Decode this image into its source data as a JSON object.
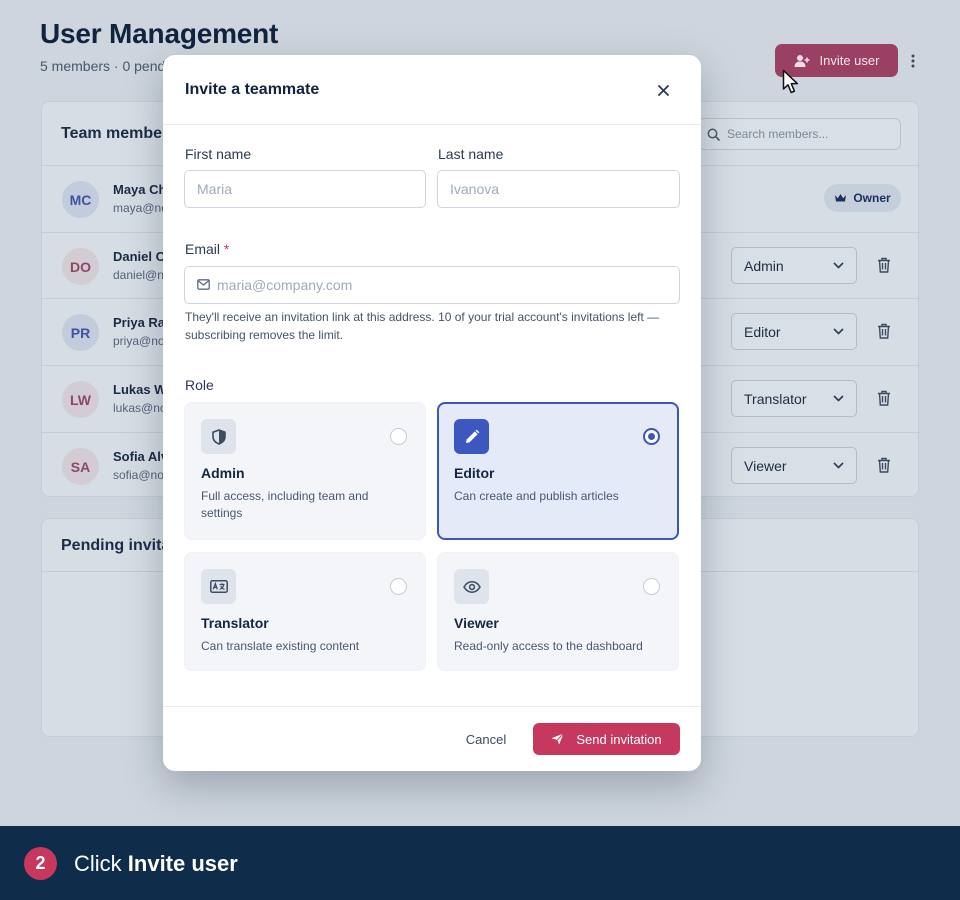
{
  "colors": {
    "accent": "#c7385f",
    "selected_role": "#3e56b8",
    "caption_bg": "#0f2c4b"
  },
  "page": {
    "title": "User Management",
    "subtitle": "5 members · 0 pend",
    "invite_button": "Invite user",
    "more_icon": "kebab-menu-icon"
  },
  "team": {
    "title": "Team members",
    "search_placeholder": "Search members...",
    "members": [
      {
        "initials": "MC",
        "name": "Maya Ch",
        "email": "maya@no",
        "badge": "Owner",
        "avatar_bg": "#c2ccdd",
        "avatar_fg": "#3f54a0"
      },
      {
        "initials": "DO",
        "name": "Daniel O",
        "email": "daniel@n",
        "role": "Admin",
        "avatar_bg": "#d3ccd3",
        "avatar_fg": "#8b4a62"
      },
      {
        "initials": "PR",
        "name": "Priya Ra",
        "email": "priya@no",
        "role": "Editor",
        "avatar_bg": "#c2ccdd",
        "avatar_fg": "#3f54a0"
      },
      {
        "initials": "LW",
        "name": "Lukas W",
        "email": "lukas@no",
        "role": "Translator",
        "avatar_bg": "#d3ccd3",
        "avatar_fg": "#8b4a62"
      },
      {
        "initials": "SA",
        "name": "Sofia Alv",
        "email": "sofia@no",
        "role": "Viewer",
        "avatar_bg": "#d3ccd3",
        "avatar_fg": "#8b4a62"
      }
    ]
  },
  "pending": {
    "title": "Pending invitat"
  },
  "modal": {
    "title": "Invite a teammate",
    "first_name_label": "First name",
    "first_name_placeholder": "Maria",
    "last_name_label": "Last name",
    "last_name_placeholder": "Ivanova",
    "email_label": "Email",
    "email_required": "*",
    "email_placeholder": "maria@company.com",
    "email_hint": "They'll receive an invitation link at this address. 10 of your trial account's invitations left — subscribing removes the limit.",
    "role_label": "Role",
    "roles": [
      {
        "name": "Admin",
        "desc": "Full access, including team and settings",
        "icon": "shield-icon",
        "selected": false
      },
      {
        "name": "Editor",
        "desc": "Can create and publish articles",
        "icon": "pencil-icon",
        "selected": true
      },
      {
        "name": "Translator",
        "desc": "Can translate existing content",
        "icon": "translate-icon",
        "selected": false
      },
      {
        "name": "Viewer",
        "desc": "Read-only access to the dashboard",
        "icon": "eye-icon",
        "selected": false
      }
    ],
    "cancel": "Cancel",
    "send": "Send invitation"
  },
  "caption": {
    "step": "2",
    "prefix": "Click ",
    "target": "Invite user"
  }
}
